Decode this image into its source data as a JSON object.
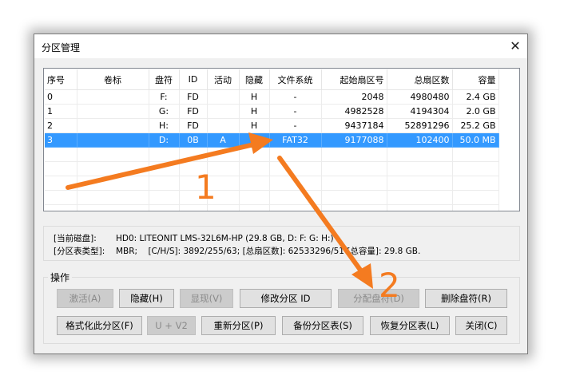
{
  "window": {
    "title": "分区管理",
    "close_glyph": "✕"
  },
  "table": {
    "headers": [
      "序号",
      "卷标",
      "盘符",
      "ID",
      "活动",
      "隐藏",
      "文件系统",
      "起始扇区号",
      "总扇区数",
      "容量"
    ],
    "rows": [
      [
        "0",
        "",
        "F:",
        "FD",
        "",
        "H",
        "-",
        "2048",
        "4980480",
        "2.4 GB"
      ],
      [
        "1",
        "",
        "G:",
        "FD",
        "",
        "H",
        "-",
        "4982528",
        "4194304",
        "2.0 GB"
      ],
      [
        "2",
        "",
        "H:",
        "FD",
        "",
        "H",
        "-",
        "9437184",
        "52891296",
        "25.2 GB"
      ],
      [
        "3",
        "",
        "D:",
        "0B",
        "A",
        "",
        "FAT32",
        "9177088",
        "102400",
        "50.0 MB"
      ]
    ],
    "selected_row_index": 3
  },
  "info": {
    "disk_label": "[当前磁盘]:",
    "disk_value": "HD0: LITEONIT LMS-32L6M-HP (29.8 GB, D: F: G: H:)",
    "type_label": "[分区表类型]:",
    "type_value": "MBR;",
    "chs": "[C/H/S]: 3892/255/63; [总扇区数]: 62533296/51",
    "total": "[总容量]: 29.8 GB."
  },
  "actions": {
    "group_label": "操作",
    "activate": "激活(A)",
    "hide": "隐藏(H)",
    "show": "显现(V)",
    "modify_id": "修改分区 ID",
    "assign_letter": "分配盘符(D)",
    "delete_letter": "删除盘符(R)",
    "format": "格式化此分区(F)",
    "uv2": "U + V2",
    "repartition": "重新分区(P)",
    "backup": "备份分区表(S)",
    "restore": "恢复分区表(L)",
    "close": "关闭(C)"
  },
  "annotations": {
    "step1": "1",
    "step2": "2",
    "arrow_color": "#f47b20"
  }
}
